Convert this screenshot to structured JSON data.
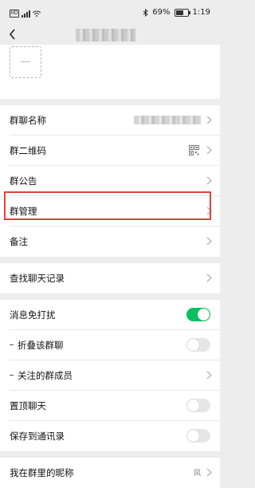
{
  "status_bar": {
    "sim_label": "HD",
    "battery_text": "69%",
    "battery_level": 0.69,
    "time": "1:19"
  },
  "nav": {
    "back_icon": "chevron-left-icon"
  },
  "add_member": {
    "icon": "dash-icon"
  },
  "sections": {
    "info": [
      {
        "label": "群聊名称",
        "type": "blurred-value"
      },
      {
        "label": "群二维码",
        "type": "qr"
      },
      {
        "label": "群公告",
        "type": "chevron"
      },
      {
        "label": "群管理",
        "type": "chevron",
        "highlighted": true
      },
      {
        "label": "备注",
        "type": "chevron"
      }
    ],
    "search": [
      {
        "label": "查找聊天记录",
        "type": "chevron"
      }
    ],
    "settings": [
      {
        "label": "消息免打扰",
        "toggle": true
      },
      {
        "label": "折叠该群聊",
        "toggle": false,
        "sub": true
      },
      {
        "label": "关注的群成员",
        "sub": true,
        "type": "chevron"
      },
      {
        "label": "置顶聊天",
        "toggle": false
      },
      {
        "label": "保存到通讯录",
        "toggle": false
      }
    ],
    "nickname": {
      "label": "我在群里的昵称",
      "value": "凤"
    }
  },
  "colors": {
    "accent_green": "#07c160",
    "highlight_red": "#e0433a",
    "background": "#ededed"
  }
}
